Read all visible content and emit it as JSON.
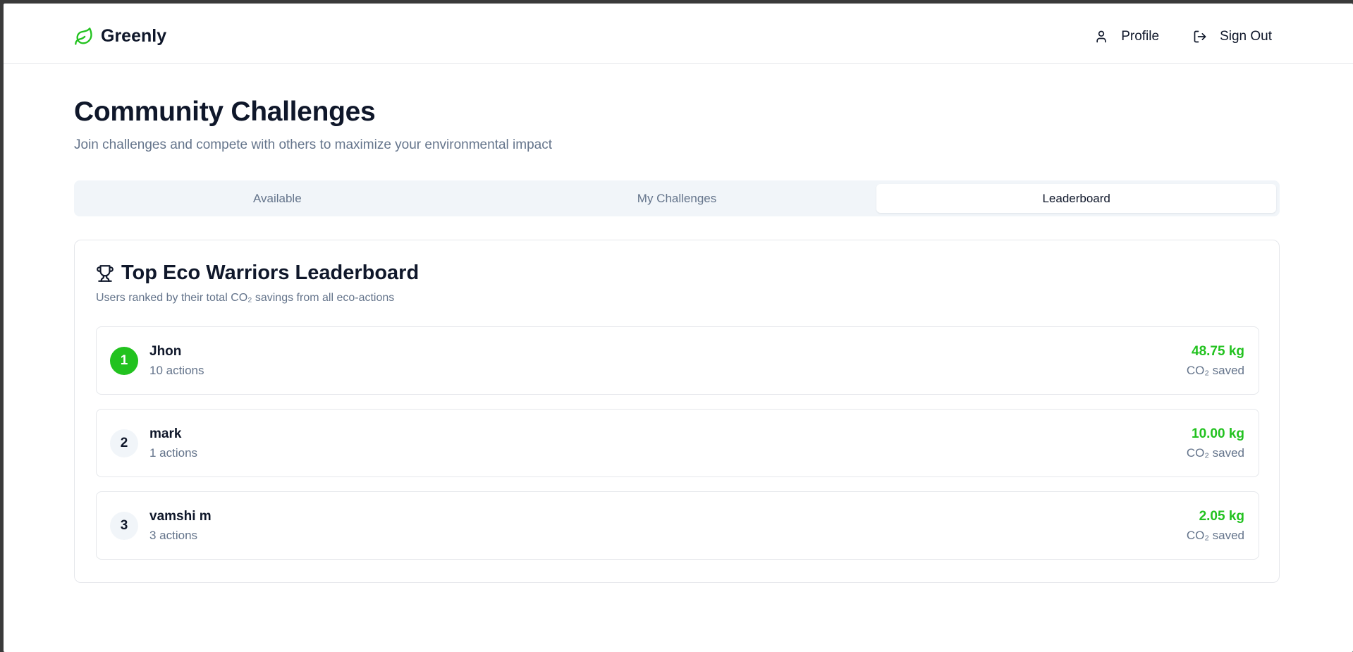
{
  "app": {
    "brand": "Greenly",
    "brand_color": "#22c21f"
  },
  "header": {
    "profile_label": "Profile",
    "signout_label": "Sign Out"
  },
  "page": {
    "title": "Community Challenges",
    "subtitle": "Join challenges and compete with others to maximize your environmental impact"
  },
  "tabs": [
    {
      "label": "Available",
      "active": false
    },
    {
      "label": "My Challenges",
      "active": false
    },
    {
      "label": "Leaderboard",
      "active": true
    }
  ],
  "leaderboard": {
    "title": "Top Eco Warriors Leaderboard",
    "description": "Users ranked by their total CO₂ savings from all eco-actions",
    "entries": [
      {
        "rank": "1",
        "name": "Jhon",
        "actions": "10 actions",
        "saved": "48.75 kg",
        "saved_label": "CO₂ saved"
      },
      {
        "rank": "2",
        "name": "mark",
        "actions": "1 actions",
        "saved": "10.00 kg",
        "saved_label": "CO₂ saved"
      },
      {
        "rank": "3",
        "name": "vamshi m",
        "actions": "3 actions",
        "saved": "2.05 kg",
        "saved_label": "CO₂ saved"
      }
    ]
  },
  "icons": {
    "brand": "leaf-icon",
    "profile": "user-icon",
    "signout": "log-out-icon",
    "leaderboard": "trophy-icon"
  }
}
